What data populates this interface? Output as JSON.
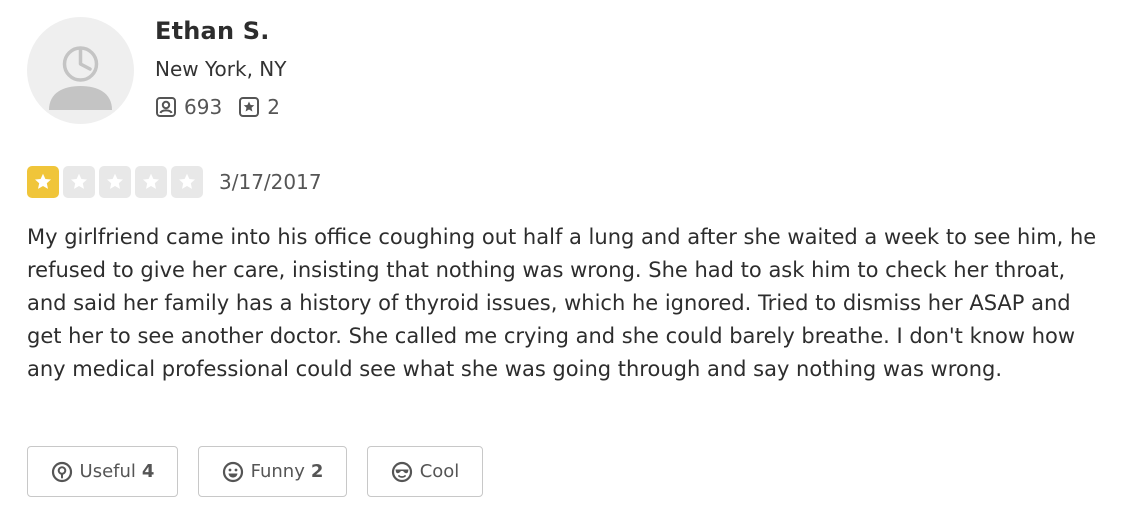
{
  "reviewer": {
    "name": "Ethan S.",
    "location": "New York, NY",
    "review_count": "693",
    "photo_count": "2",
    "avatar_icon": "default-user-avatar-icon"
  },
  "review": {
    "rating": 1,
    "rating_max": 5,
    "star_fill_color": "#f0c53a",
    "star_empty_color": "#e8e8e8",
    "date": "3/17/2017",
    "text": "My girlfriend came into his office coughing out half a lung and after she waited a week to see him, he refused to give her care, insisting that nothing was wrong. She had to ask him to check her throat, and said her family has a history of thyroid issues, which he ignored. Tried to dismiss her ASAP and get her to see another doctor. She called me crying and she could barely breathe. I don't know how any medical professional could see what she was going through and say nothing was wrong."
  },
  "votes": {
    "useful": {
      "label": "Useful",
      "count": "4",
      "icon": "lightbulb-icon"
    },
    "funny": {
      "label": "Funny",
      "count": "2",
      "icon": "smile-icon"
    },
    "cool": {
      "label": "Cool",
      "count": "",
      "icon": "sunglasses-icon"
    }
  }
}
